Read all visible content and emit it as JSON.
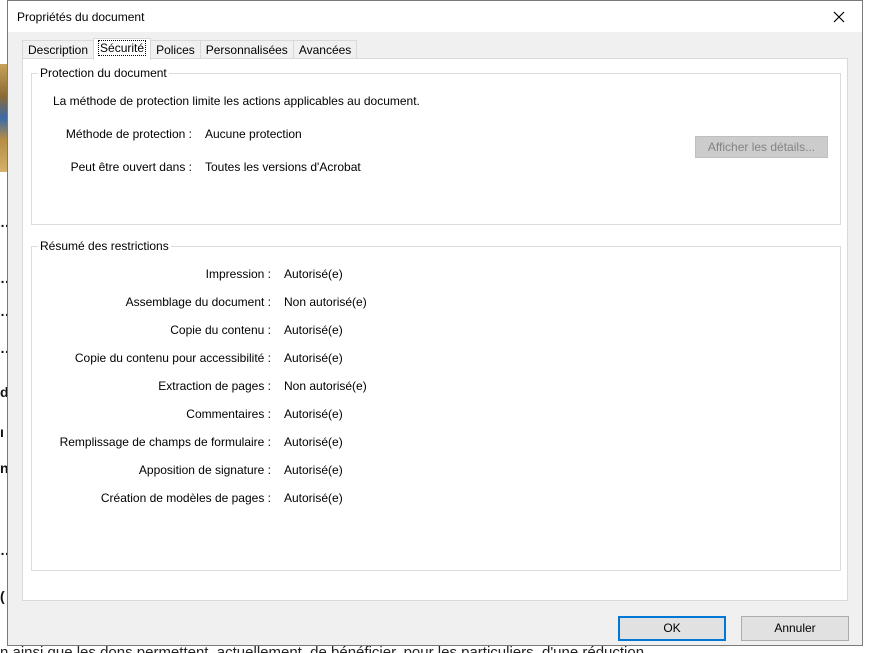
{
  "dialog": {
    "title": "Propriétés du document",
    "close_icon": "close-icon"
  },
  "tabs": [
    {
      "label": "Description",
      "active": false
    },
    {
      "label": "Sécurité",
      "active": true
    },
    {
      "label": "Polices",
      "active": false
    },
    {
      "label": "Personnalisées",
      "active": false
    },
    {
      "label": "Avancées",
      "active": false
    }
  ],
  "protection": {
    "group_title": "Protection du document",
    "intro": "La méthode de protection limite les actions applicables au document.",
    "method_label": "Méthode de protection :",
    "method_value": "Aucune protection",
    "opens_label": "Peut être ouvert dans :",
    "opens_value": "Toutes les versions d'Acrobat",
    "details_button": "Afficher les détails..."
  },
  "restrictions": {
    "group_title": "Résumé des restrictions",
    "items": [
      {
        "label": "Impression :",
        "value": "Autorisé(e)"
      },
      {
        "label": "Assemblage du document :",
        "value": "Non autorisé(e)"
      },
      {
        "label": "Copie du contenu :",
        "value": "Autorisé(e)"
      },
      {
        "label": "Copie du contenu pour accessibilité :",
        "value": "Autorisé(e)"
      },
      {
        "label": "Extraction de pages :",
        "value": "Non autorisé(e)"
      },
      {
        "label": "Commentaires :",
        "value": "Autorisé(e)"
      },
      {
        "label": "Remplissage de champs de formulaire :",
        "value": "Autorisé(e)"
      },
      {
        "label": "Apposition de signature :",
        "value": "Autorisé(e)"
      },
      {
        "label": "Création de modèles de pages :",
        "value": "Autorisé(e)"
      }
    ]
  },
  "footer": {
    "ok_label": "OK",
    "cancel_label": "Annuler"
  },
  "background": {
    "bottom_text": "n ainsi que les dons permettent, actuellement, de bénéficier, pour les particuliers, d'une réduction",
    "fragments": [
      "…",
      "…",
      "…",
      "…",
      "d",
      "ı",
      "n",
      "…",
      "("
    ]
  },
  "colors": {
    "accent": "#0078d7",
    "dialog_bg": "#f0f0f0",
    "panel_bg": "#ffffff",
    "disabled_button_bg": "#cccccc",
    "disabled_text": "#838383"
  }
}
